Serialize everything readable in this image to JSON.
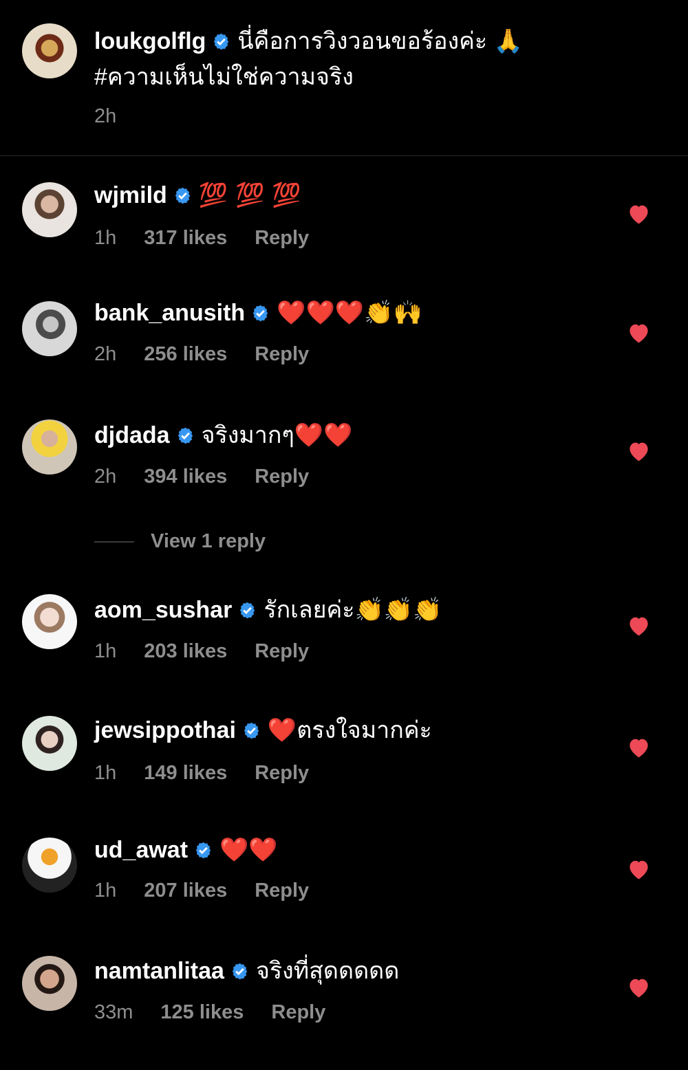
{
  "post": {
    "username": "loukgolflg",
    "text": "นี่คือการวิงวอนขอร้องค่ะ 🙏",
    "tag": "#ความเห็นไม่ใช่ความจริง",
    "time": "2h"
  },
  "comments": [
    {
      "username": "wjmild",
      "text": "💯 💯 💯",
      "time": "1h",
      "likes": "317 likes",
      "reply": "Reply"
    },
    {
      "username": "bank_anusith",
      "text": "❤️❤️❤️👏🙌",
      "time": "2h",
      "likes": "256 likes",
      "reply": "Reply"
    },
    {
      "username": "djdada",
      "text": "จริงมากๆ❤️❤️",
      "time": "2h",
      "likes": "394 likes",
      "reply": "Reply"
    },
    {
      "username": "aom_sushar",
      "text": "รักเลยค่ะ👏👏👏",
      "time": "1h",
      "likes": "203 likes",
      "reply": "Reply"
    },
    {
      "username": "jewsippothai",
      "text": "❤️ตรงใจมากค่ะ",
      "time": "1h",
      "likes": "149 likes",
      "reply": "Reply"
    },
    {
      "username": "ud_awat",
      "text": "❤️❤️",
      "time": "1h",
      "likes": "207 likes",
      "reply": "Reply"
    },
    {
      "username": "namtanlitaa",
      "text": "จริงที่สุดดดดด",
      "time": "33m",
      "likes": "125 likes",
      "reply": "Reply"
    }
  ],
  "view_reply": "View 1 reply",
  "colors": {
    "background": "#000000",
    "muted": "#8e8e8e",
    "verified": "#3897f0",
    "heart": "#ed4956"
  },
  "icons": {
    "verified": "verified-badge-icon",
    "heart": "heart-icon"
  }
}
